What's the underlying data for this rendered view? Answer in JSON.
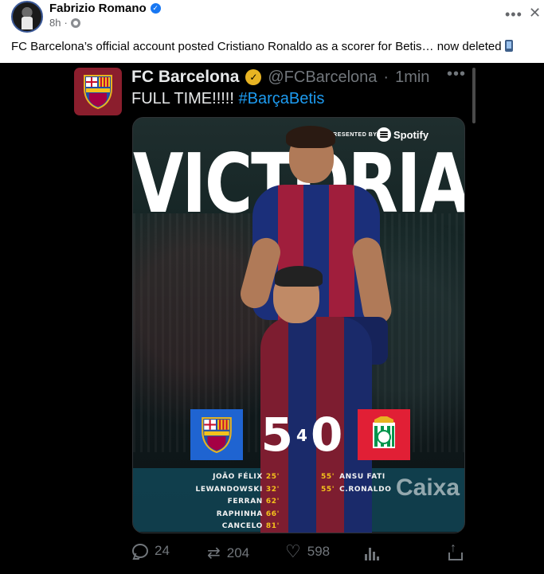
{
  "post": {
    "author": "Fabrizio Romano",
    "time": "8h",
    "caption": "FC Barcelona’s official account posted Cristiano Ronaldo as a scorer for Betis… now deleted",
    "more_icon": "more-horizontal-icon",
    "close_icon": "close-icon"
  },
  "tweet": {
    "name": "FC Barcelona",
    "handle": "@FCBarcelona",
    "dot": "·",
    "time": "1min",
    "text_plain": "FULL TIME!!!!! ",
    "hashtag": "#BarçaBetis",
    "crest_label": "FCB"
  },
  "graphic": {
    "presented_by": "PRESENTED BY",
    "sponsor": "Spotify",
    "headline": "VICTORIA",
    "home_crest": "FCB",
    "away_crest": "RB",
    "home_score": "5",
    "score_separator": "4",
    "away_score": "0",
    "ad_text": "Caixa",
    "home_scorers": [
      {
        "name": "JOÃO FÉLIX",
        "minute": "25'"
      },
      {
        "name": "LEWANDOWSKI",
        "minute": "32'"
      },
      {
        "name": "FERRAN",
        "minute": "62'"
      },
      {
        "name": "RAPHINHA",
        "minute": "66'"
      },
      {
        "name": "CANCELO",
        "minute": "81'"
      }
    ],
    "away_scorers": [
      {
        "name": "ANSU FATI",
        "minute": "55'"
      },
      {
        "name": "C.RONALDO",
        "minute": "55'"
      }
    ]
  },
  "actions": {
    "replies": "24",
    "retweets": "204",
    "likes": "598"
  },
  "colors": {
    "facebook_blue": "#1877f2",
    "twitter_link": "#1d9bf0",
    "minute_yellow": "#f4c21c",
    "barca_blue": "#1f64d1",
    "betis_red": "#e11f35"
  }
}
